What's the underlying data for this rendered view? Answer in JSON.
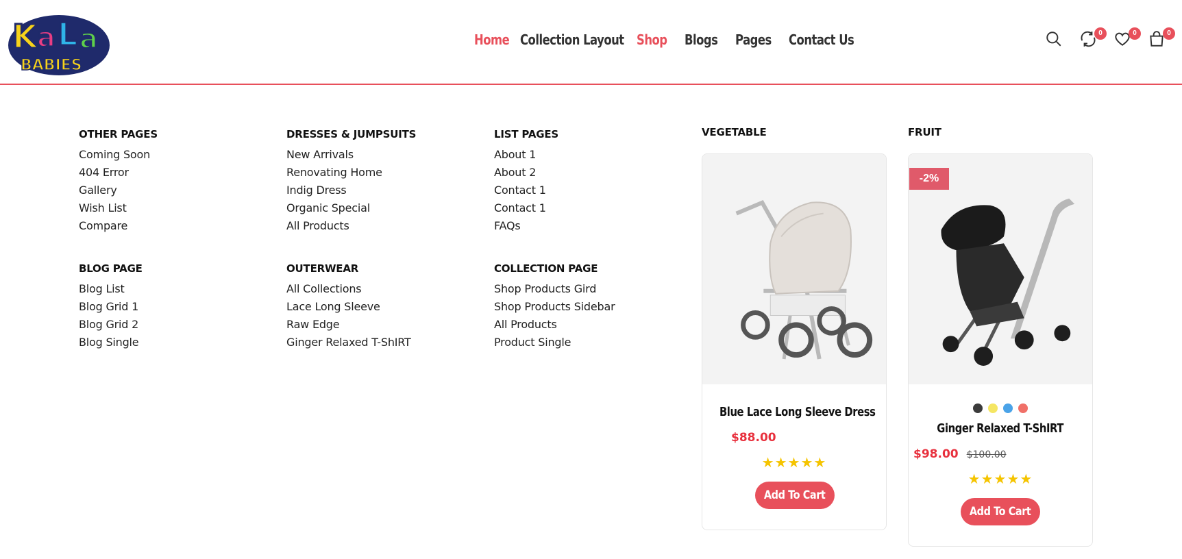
{
  "brand": {
    "logo_top": "KaLa",
    "logo_bottom": "BABIES"
  },
  "nav": [
    {
      "label": "Home",
      "active": true
    },
    {
      "label": "Collection Layout",
      "active": false
    },
    {
      "label": "Shop",
      "active": true
    },
    {
      "label": "Blogs",
      "active": false
    },
    {
      "label": "Pages",
      "active": false
    },
    {
      "label": "Contact Us",
      "active": false
    }
  ],
  "header_icons": {
    "search": "search-icon",
    "compare": {
      "icon": "compare-icon",
      "count": "0"
    },
    "wishlist": {
      "icon": "heart-icon",
      "count": "0"
    },
    "cart": {
      "icon": "bag-icon",
      "count": "0"
    }
  },
  "menu": {
    "other_pages": {
      "heading": "OTHER PAGES",
      "links": [
        "Coming Soon",
        "404 Error",
        "Gallery",
        "Wish List",
        "Compare"
      ]
    },
    "blog_page": {
      "heading": "BLOG PAGE",
      "links": [
        "Blog List",
        "Blog Grid 1",
        "Blog Grid 2",
        "Blog Single"
      ]
    },
    "dresses": {
      "heading": "DRESSES & JUMPSUITS",
      "links": [
        "New Arrivals",
        "Renovating Home",
        "Indig Dress",
        "Organic Special",
        "All Products"
      ]
    },
    "outerwear": {
      "heading": "OUTERWEAR",
      "links": [
        "All Collections",
        "Lace Long Sleeve",
        "Raw Edge",
        "Ginger Relaxed T-ShIRT"
      ]
    },
    "list_pages": {
      "heading": "LIST PAGES",
      "links": [
        "About 1",
        "About 2",
        "Contact 1",
        "Contact 1",
        "FAQs"
      ]
    },
    "collection_page": {
      "heading": "COLLECTION PAGE",
      "links": [
        "Shop Products Gird",
        "Shop Products Sidebar",
        "All Products",
        "Product Single"
      ]
    }
  },
  "products": {
    "vegetable": {
      "heading": "VEGETABLE",
      "name": "Blue Lace Long Sleeve Dress",
      "price": "$88.00",
      "rating": "★★★★★",
      "button": "Add To Cart"
    },
    "fruit": {
      "heading": "FRUIT",
      "discount": "-2%",
      "swatches": [
        "#3b3b3b",
        "#f5e663",
        "#4aa3e8",
        "#f07068"
      ],
      "name": "Ginger Relaxed T-ShIRT",
      "price": "$98.00",
      "old_price": "$100.00",
      "rating": "★★★★★",
      "button": "Add To Cart"
    }
  },
  "colors": {
    "accent": "#e8505b",
    "price": "#e8303d",
    "star": "#f5c400"
  }
}
